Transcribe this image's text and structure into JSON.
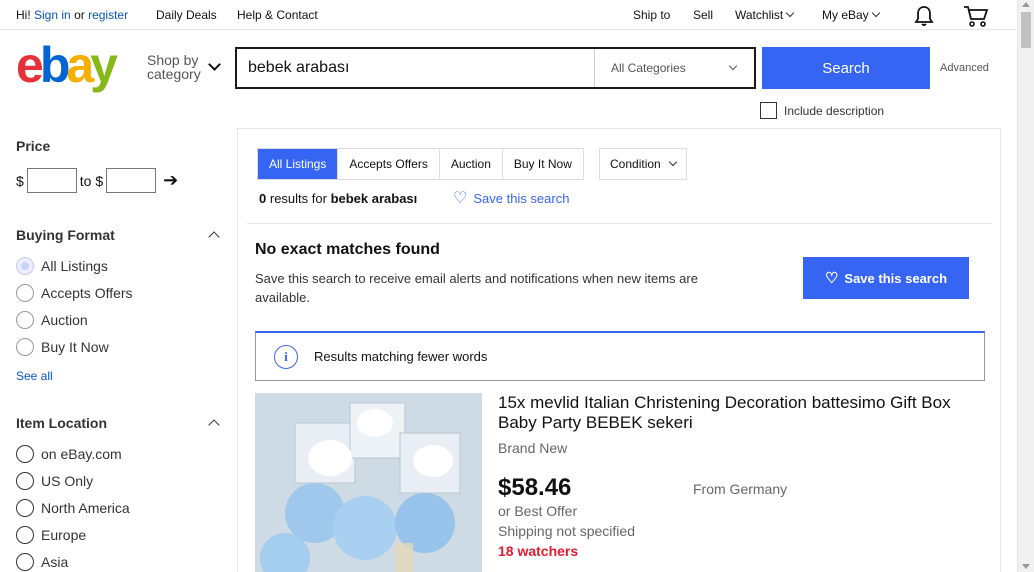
{
  "topbar": {
    "greeting": "Hi!",
    "signin": "Sign in",
    "or": "or",
    "register": "register",
    "daily_deals": "Daily Deals",
    "help": "Help & Contact",
    "ship_to": "Ship to",
    "sell": "Sell",
    "watchlist": "Watchlist",
    "my_ebay": "My eBay",
    "icons": [
      "bell-icon",
      "cart-icon"
    ]
  },
  "header": {
    "logo": "ebay",
    "shop_by_1": "Shop by",
    "shop_by_2": "category",
    "search_value": "bebek arabası",
    "category": "All Categories",
    "search_button": "Search",
    "advanced": "Advanced",
    "include_description": "Include description"
  },
  "sidebar": {
    "price_heading": "Price",
    "currency": "$",
    "to": "to $",
    "buying_format_heading": "Buying Format",
    "buying_formats": [
      "All Listings",
      "Accepts Offers",
      "Auction",
      "Buy It Now"
    ],
    "see_all": "See all",
    "location_heading": "Item Location",
    "locations": [
      "on eBay.com",
      "US Only",
      "North America",
      "Europe",
      "Asia"
    ]
  },
  "main": {
    "tabs": [
      "All Listings",
      "Accepts Offers",
      "Auction",
      "Buy It Now"
    ],
    "active_tab": "All Listings",
    "condition": "Condition",
    "results_count": "0",
    "results_for": "results for",
    "query": "bebek arabası",
    "save_search_link": "Save this search",
    "no_match_heading": "No exact matches found",
    "no_match_text": "Save this search to receive email alerts and notifications when new items are available.",
    "save_button": "Save this search",
    "info_text": "Results matching fewer words"
  },
  "item": {
    "title": "15x mevlid Italian Christening Decoration battesimo Gift Box Baby Party BEBEK sekeri",
    "condition": "Brand New",
    "price": "$58.46",
    "offer": "or Best Offer",
    "shipping": "Shipping not specified",
    "watchers": "18 watchers",
    "from": "From Germany"
  },
  "colors": {
    "accent": "#3665f3",
    "link": "#0654ba",
    "watchers": "#dd1e31"
  }
}
